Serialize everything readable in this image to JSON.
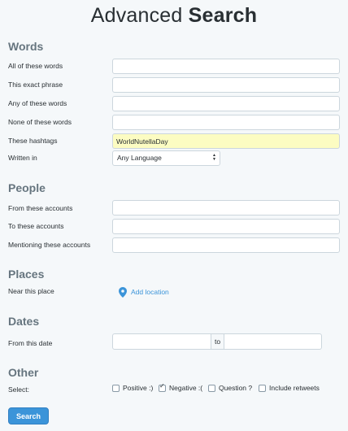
{
  "title": {
    "light": "Advanced ",
    "bold": "Search"
  },
  "words": {
    "heading": "Words",
    "all_label": "All of these words",
    "all_value": "",
    "exact_label": "This exact phrase",
    "exact_value": "",
    "any_label": "Any of these words",
    "any_value": "",
    "none_label": "None of these words",
    "none_value": "",
    "hashtags_label": "These hashtags",
    "hashtags_value": "WorldNutellaDay",
    "language_label": "Written in",
    "language_value": "Any Language"
  },
  "people": {
    "heading": "People",
    "from_label": "From these accounts",
    "from_value": "",
    "to_label": "To these accounts",
    "to_value": "",
    "mention_label": "Mentioning these accounts",
    "mention_value": ""
  },
  "places": {
    "heading": "Places",
    "near_label": "Near this place",
    "add_location": "Add location",
    "icon": "location-pin-icon"
  },
  "dates": {
    "heading": "Dates",
    "from_label": "From this date",
    "to_word": "to",
    "from_value": "",
    "to_value": ""
  },
  "other": {
    "heading": "Other",
    "select_label": "Select:",
    "options": [
      {
        "label": "Positive :)",
        "checked": false
      },
      {
        "label": "Negative :(",
        "checked": true
      },
      {
        "label": "Question ?",
        "checked": false
      },
      {
        "label": "Include retweets",
        "checked": false
      }
    ]
  },
  "search_button": "Search",
  "colors": {
    "accent": "#3b94d9",
    "heading": "#66757f",
    "highlight": "#fcfcc2"
  }
}
